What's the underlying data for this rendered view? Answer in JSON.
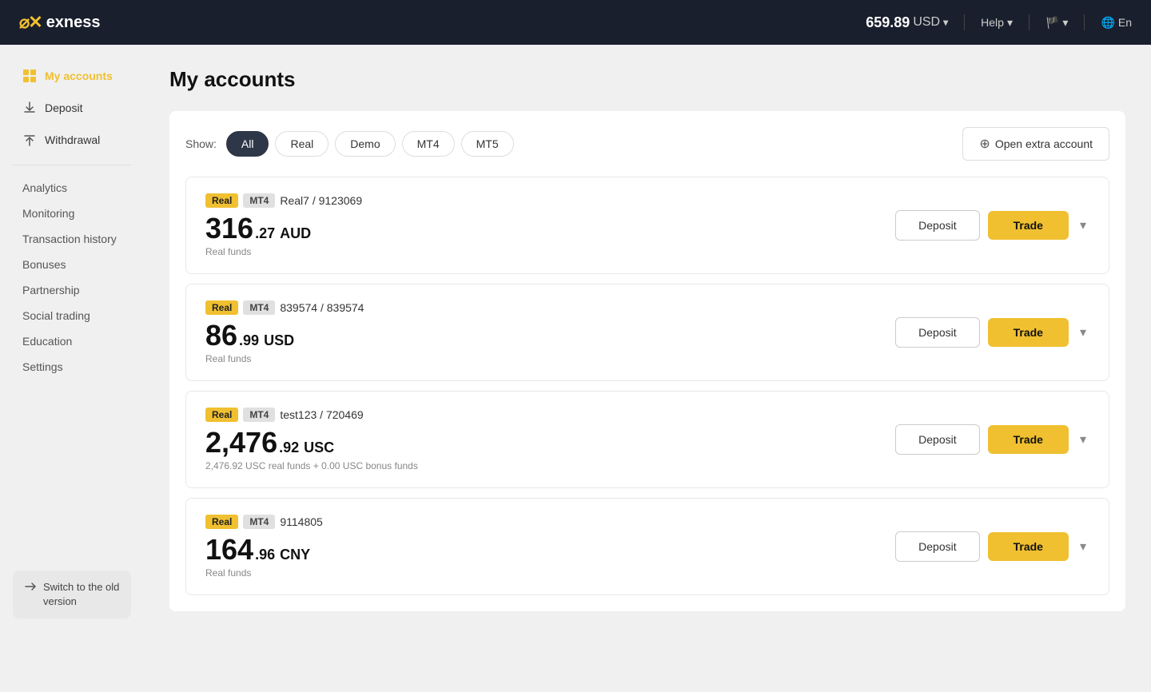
{
  "topnav": {
    "logo_icon": "⁓✕",
    "logo_text": "exness",
    "balance": "659.89",
    "balance_currency": "USD",
    "help_label": "Help",
    "language_label": "En"
  },
  "sidebar": {
    "my_accounts_label": "My accounts",
    "deposit_label": "Deposit",
    "withdrawal_label": "Withdrawal",
    "sub_items": [
      {
        "label": "Analytics"
      },
      {
        "label": "Monitoring"
      },
      {
        "label": "Transaction history"
      },
      {
        "label": "Bonuses"
      },
      {
        "label": "Partnership"
      },
      {
        "label": "Social trading"
      },
      {
        "label": "Education"
      },
      {
        "label": "Settings"
      }
    ],
    "switch_old_version_label": "Switch to the old version"
  },
  "page": {
    "title": "My accounts"
  },
  "filters": {
    "show_label": "Show:",
    "buttons": [
      {
        "label": "All",
        "active": true
      },
      {
        "label": "Real",
        "active": false
      },
      {
        "label": "Demo",
        "active": false
      },
      {
        "label": "MT4",
        "active": false
      },
      {
        "label": "MT5",
        "active": false
      }
    ],
    "open_extra_label": "Open extra account"
  },
  "accounts": [
    {
      "type": "Real",
      "platform": "MT4",
      "name": "Real7 / 9123069",
      "balance_main": "316",
      "balance_decimal": ".27",
      "balance_currency": "AUD",
      "sub_text": "Real funds"
    },
    {
      "type": "Real",
      "platform": "MT4",
      "name": "839574 / 839574",
      "balance_main": "86",
      "balance_decimal": ".99",
      "balance_currency": "USD",
      "sub_text": "Real funds"
    },
    {
      "type": "Real",
      "platform": "MT4",
      "name": "test123 / 720469",
      "balance_main": "2,476",
      "balance_decimal": ".92",
      "balance_currency": "USC",
      "sub_text": "2,476.92 USC real funds + 0.00 USC bonus funds"
    },
    {
      "type": "Real",
      "platform": "MT4",
      "name": "9114805",
      "balance_main": "164",
      "balance_decimal": ".96",
      "balance_currency": "CNY",
      "sub_text": "Real funds"
    }
  ],
  "buttons": {
    "deposit_label": "Deposit",
    "trade_label": "Trade"
  }
}
